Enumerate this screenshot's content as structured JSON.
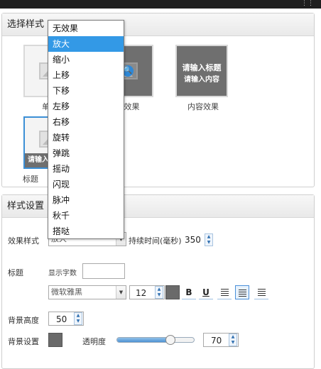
{
  "window": {
    "resize_glyph": "⋮⋮"
  },
  "style_section": {
    "title": "选择样式",
    "thumbs": [
      {
        "caption": "单图"
      },
      {
        "caption": "点效果"
      },
      {
        "caption": "内容效果",
        "title_line1": "请输入标题",
        "title_line2": "请输入内容"
      },
      {
        "caption": "标题",
        "overlay_text": "请输入标题"
      }
    ]
  },
  "dropdown": {
    "items": [
      "无效果",
      "放大",
      "缩小",
      "上移",
      "下移",
      "左移",
      "右移",
      "旋转",
      "弹跳",
      "摇动",
      "闪现",
      "脉冲",
      "秋千",
      "搭哒"
    ],
    "selected_index": 1
  },
  "settings_section": {
    "title": "样式设置",
    "effect_label": "效果样式",
    "effect_value": "放大",
    "duration_label": "持续时间(毫秒)",
    "duration_value": "350",
    "title_label": "标题",
    "show_chars_label": "显示字数",
    "show_chars_value": "",
    "font_value": "微软雅黑",
    "font_size": "12",
    "font_color": "#6a6a6a",
    "bold": "B",
    "underline": "U",
    "bg_height_label": "背景高度",
    "bg_height_value": "50",
    "bg_setting_label": "背景设置",
    "bg_color": "#6a6a6a",
    "opacity_label": "透明度",
    "opacity_value": "70",
    "opacity_fraction": 0.7
  },
  "accent_color": "#3399e6"
}
